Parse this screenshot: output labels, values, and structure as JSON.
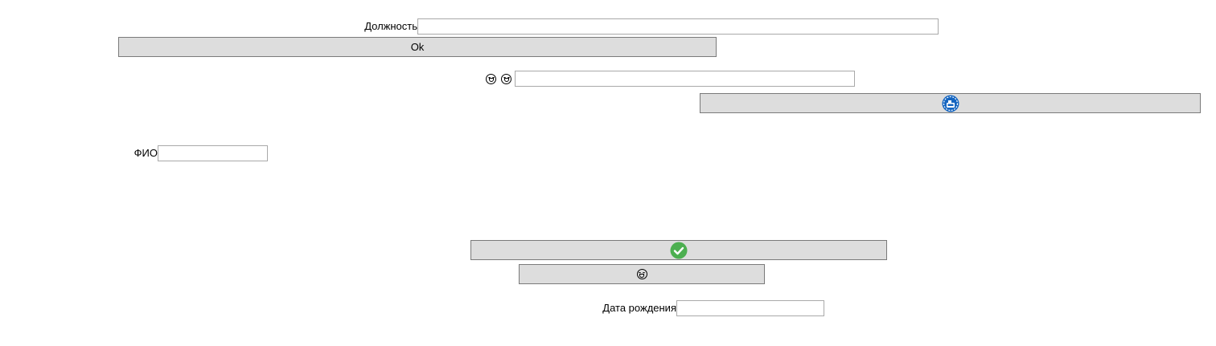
{
  "form": {
    "position_label": "Должность",
    "position_value": "",
    "ok_button_label": "Ok",
    "emoji_field_value": "",
    "fio_label": "ФИО",
    "fio_value": "",
    "birthdate_label": "Дата рождения",
    "birthdate_value": ""
  },
  "icons": {
    "emoji_laughing": "laughing-face-icon",
    "emoji_grinning": "grinning-face-icon",
    "save_icon": "save-icon",
    "checkmark_icon": "checkmark-icon",
    "button_emoji_icon": "laughing-face-icon"
  },
  "colors": {
    "button_bg": "#dddddd",
    "button_border": "#7a7a7a",
    "field_border": "#a9a9a9",
    "save_icon_blue": "#1565c0",
    "check_green": "#4caf50"
  }
}
